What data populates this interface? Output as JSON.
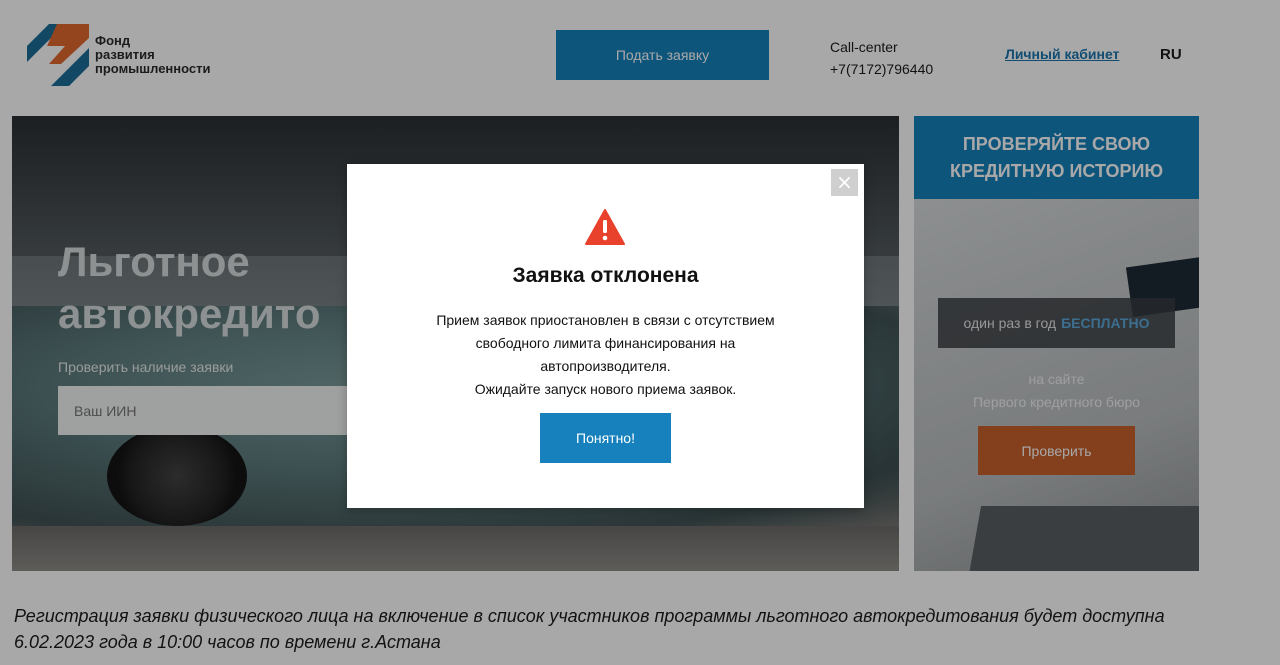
{
  "header": {
    "logo_lines": [
      "Фонд",
      "развития",
      "промышленности"
    ],
    "apply_label": "Подать заявку",
    "call_center_label": "Call-center",
    "call_center_phone": "+7(7172)796440",
    "cabinet_label": "Личный кабинет",
    "language": "RU"
  },
  "hero": {
    "title_lines": [
      "Льготное",
      "автокредито"
    ],
    "check_label": "Проверить наличие заявки",
    "iin_placeholder": "Ваш ИИН"
  },
  "side_banner": {
    "title_lines": [
      "ПРОВЕРЯЙТЕ СВОЮ",
      "КРЕДИТНУЮ ИСТОРИЮ"
    ],
    "badge_text": "один раз в год",
    "badge_free": "БЕСПЛАТНО",
    "site_lines": [
      "на сайте",
      "Первого кредитного бюро"
    ],
    "check_button": "Проверить"
  },
  "notice": {
    "text": "Регистрация заявки физического лица на включение в список участников программы льготного автокредитования будет доступна 6.02.2023 года в 10:00 часов по времени г.Астана"
  },
  "modal": {
    "close_glyph": "×",
    "icon": "warning-icon",
    "title": "Заявка отклонена",
    "message_lines": [
      "Прием заявок приостановлен в связи с отсутствием",
      "свободного лимита финансирования на",
      "автопроизводителя.",
      "Ожидайте запуск нового приема заявок."
    ],
    "ok_button": "Понятно!"
  },
  "colors": {
    "primary_blue": "#1681bd",
    "accent_orange": "#c9622c",
    "warning_red": "#e8412c"
  }
}
